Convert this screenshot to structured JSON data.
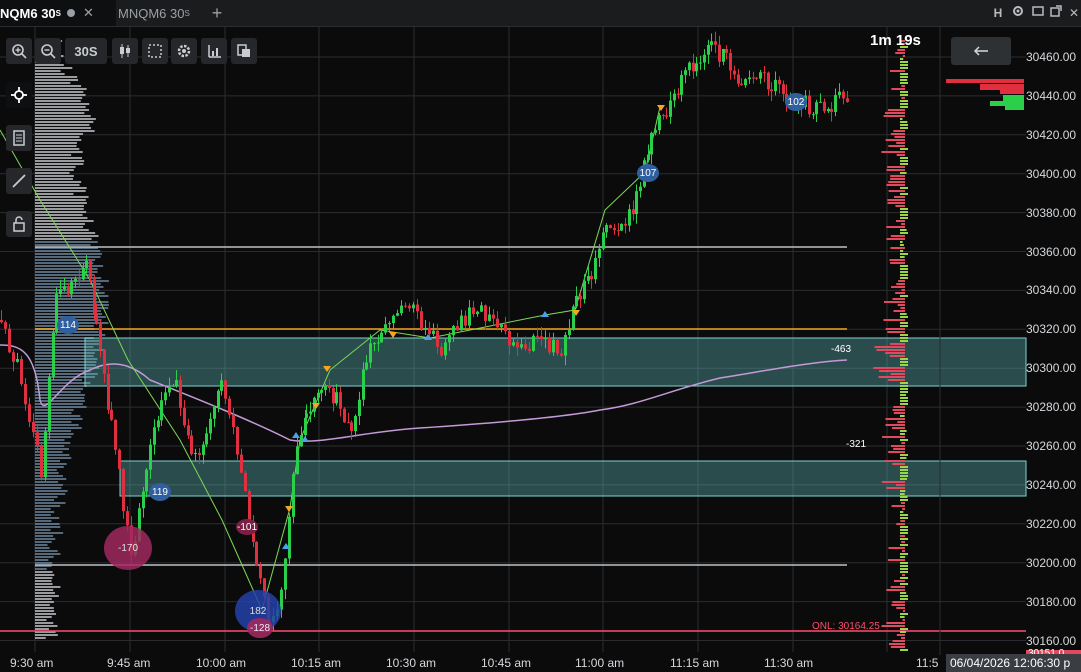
{
  "tabs": {
    "active_symbol": "NQM6",
    "active_interval": "30",
    "active_unit": "S",
    "inactive_symbol": "MNQM6",
    "inactive_interval": "30",
    "inactive_unit": "S",
    "close_glyph": "✕",
    "add_glyph": "+"
  },
  "window_controls": {
    "h_label": "H"
  },
  "toolbar": {
    "interval_label": "30S"
  },
  "timer": "1m 19s",
  "y_axis": {
    "ticks": [
      "30460.00",
      "30440.00",
      "30420.00",
      "30400.00",
      "30380.00",
      "30360.00",
      "30340.00",
      "30320.00",
      "30300.00",
      "30280.00",
      "30260.00",
      "30240.00",
      "30220.00",
      "30200.00",
      "30180.00",
      "30160.00"
    ],
    "cut_label": "30151.0"
  },
  "x_axis": {
    "ticks": [
      "9:30 am",
      "9:45 am",
      "10:00 am",
      "10:15 am",
      "10:30 am",
      "10:45 am",
      "11:00 am",
      "11:15 am",
      "11:30 am",
      "11:5"
    ]
  },
  "datetime": "06/04/2026 12:06:30 p",
  "annotations": {
    "onl_label": "ONL: 30164.25",
    "delta_labels": [
      "114",
      "119",
      "-101",
      "-170",
      "182",
      "-128",
      "107",
      "102",
      "-463",
      "-321"
    ]
  },
  "colors": {
    "up": "#2bd04a",
    "down": "#e0303f",
    "zone": "#5fb7b7",
    "vwap": "#c29ad6",
    "orange": "#f5a623",
    "onl": "#ff4d6d"
  },
  "icons": [
    "zoom-in-icon",
    "zoom-out-icon",
    "candles-icon",
    "select-box-icon",
    "gear-icon",
    "bar-stats-icon",
    "copy-icon",
    "crosshair-icon",
    "note-icon",
    "line-draw-icon",
    "lock-icon",
    "back-arrow-icon"
  ]
}
